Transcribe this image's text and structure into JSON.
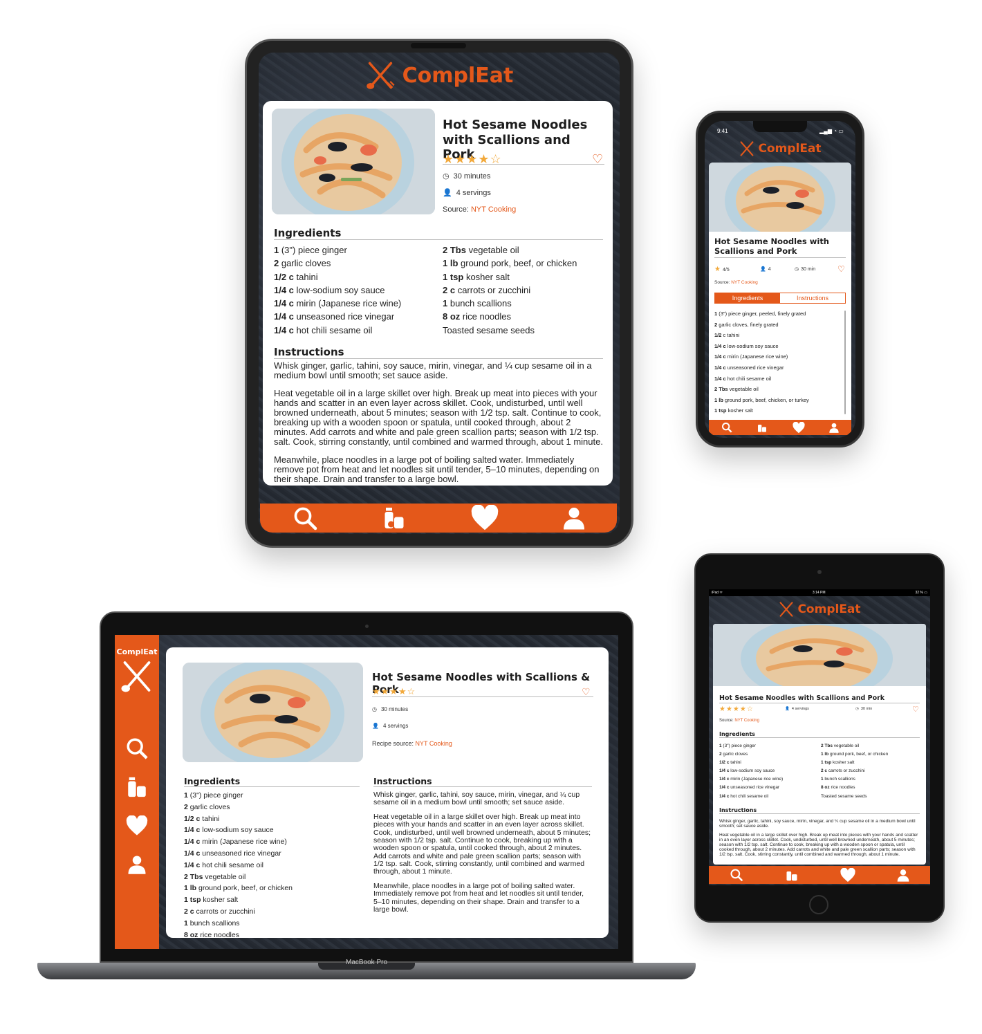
{
  "app": {
    "name": "ComplEat",
    "accent": "#e4581a",
    "star_color": "#f2a93b"
  },
  "recipe": {
    "title_line1": "Hot Sesame Noodles",
    "title_line2": "with Scallions and Pork",
    "title_phone_line1": "Hot Sesame Noodles with",
    "title_phone_line2": "Scallions and Pork",
    "title_laptop": "Hot Sesame Noodles with Scallions & Pork",
    "title_mini": "Hot Sesame Noodles with Scallions and Pork",
    "stars": "★★★★☆",
    "rating_label": "4/5",
    "time": "30 minutes",
    "time_short": "30 min",
    "servings": "4 servings",
    "servings_short": "4",
    "source_label": "Source:",
    "source_label_laptop": "Recipe source:",
    "source_name": "NYT Cooking"
  },
  "labels": {
    "ingredients": "Ingredients",
    "instructions": "Instructions",
    "laptop_model": "MacBook Pro"
  },
  "phone_status": {
    "time": "9:41"
  },
  "ipad_status": {
    "left": "iPad ᯤ",
    "time": "3:14 PM",
    "right": "32 % ▭"
  },
  "phone_tabs": {
    "ingredients": "Ingredients",
    "instructions": "Instructions"
  },
  "ingredients_col1": [
    {
      "q": "1",
      "t": " (3\") piece ginger"
    },
    {
      "q": "2",
      "t": " garlic cloves"
    },
    {
      "q": "1/2 c",
      "t": " tahini"
    },
    {
      "q": "1/4 c",
      "t": " low-sodium soy sauce"
    },
    {
      "q": "1/4 c",
      "t": " mirin (Japanese rice wine)"
    },
    {
      "q": "1/4 c",
      "t": " unseasoned rice vinegar"
    },
    {
      "q": "1/4 c",
      "t": " hot chili sesame oil"
    }
  ],
  "ingredients_col2": [
    {
      "q": "2 Tbs",
      "t": " vegetable oil"
    },
    {
      "q": "1 lb",
      "t": " ground pork, beef, or chicken"
    },
    {
      "q": "1 tsp",
      "t": " kosher salt"
    },
    {
      "q": "2 c",
      "t": " carrots or zucchini"
    },
    {
      "q": "1",
      "t": " bunch scallions"
    },
    {
      "q": "8 oz",
      "t": " rice noodles"
    },
    {
      "q": "",
      "t": "Toasted sesame seeds"
    }
  ],
  "ingredients_phone": [
    {
      "q": "1",
      "t": " (3\") piece ginger, peeled, finely grated"
    },
    {
      "q": "2",
      "t": " garlic cloves, finely grated"
    },
    {
      "q": "1/2",
      "t": " c tahini"
    },
    {
      "q": "1/4 c",
      "t": " low-sodium soy sauce"
    },
    {
      "q": "1/4 c",
      "t": " mirin (Japanese rice wine)"
    },
    {
      "q": "1/4 c",
      "t": " unseasoned rice vinegar"
    },
    {
      "q": "1/4 c",
      "t": " hot chili sesame oil"
    },
    {
      "q": "2 Tbs",
      "t": " vegetable oil"
    },
    {
      "q": "1 lb",
      "t": " ground pork, beef, chicken, or turkey"
    },
    {
      "q": "1 tsp",
      "t": " kosher salt"
    }
  ],
  "instructions": [
    "Whisk ginger, garlic, tahini, soy sauce, mirin, vinegar, and ¼ cup sesame oil in a medium bowl until smooth; set sauce aside.",
    "Heat vegetable oil in a large skillet over high. Break up meat into pieces with your hands and scatter in an even layer across skillet. Cook, undisturbed, until well browned underneath, about 5 minutes; season with 1/2 tsp. salt. Continue to cook, breaking up with a wooden spoon or spatula, until cooked through, about 2 minutes. Add carrots and white and pale green scallion parts; season with 1/2 tsp. salt. Cook, stirring constantly, until combined and warmed through, about 1 minute.",
    "Meanwhile, place noodles in a large pot of boiling salted water. Immediately remove pot from heat and let noodles sit until tender, 5–10 minutes, depending on their shape. Drain and transfer to a large bowl."
  ]
}
